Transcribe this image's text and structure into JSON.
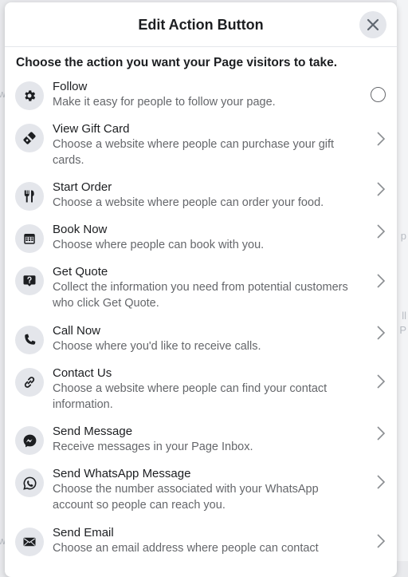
{
  "header": {
    "title": "Edit Action Button"
  },
  "subtitle": "Choose the action you want your Page visitors to take.",
  "items": [
    {
      "label": "Follow",
      "description": "Make it easy for people to follow your page.",
      "icon": "gear-icon",
      "control": "radio"
    },
    {
      "label": "View Gift Card",
      "description": "Choose a website where people can purchase your gift cards.",
      "icon": "gift-card-icon",
      "control": "chevron"
    },
    {
      "label": "Start Order",
      "description": "Choose a website where people can order your food.",
      "icon": "fork-knife-icon",
      "control": "chevron"
    },
    {
      "label": "Book Now",
      "description": "Choose where people can book with you.",
      "icon": "calendar-icon",
      "control": "chevron"
    },
    {
      "label": "Get Quote",
      "description": "Collect the information you need from potential customers who click Get Quote.",
      "icon": "question-bubble-icon",
      "control": "chevron"
    },
    {
      "label": "Call Now",
      "description": "Choose where you'd like to receive calls.",
      "icon": "phone-icon",
      "control": "chevron"
    },
    {
      "label": "Contact Us",
      "description": "Choose a website where people can find your contact information.",
      "icon": "link-icon",
      "control": "chevron"
    },
    {
      "label": "Send Message",
      "description": "Receive messages in your Page Inbox.",
      "icon": "messenger-icon",
      "control": "chevron"
    },
    {
      "label": "Send WhatsApp Message",
      "description": "Choose the number associated with your WhatsApp account so people can reach you.",
      "icon": "whatsapp-icon",
      "control": "chevron"
    },
    {
      "label": "Send Email",
      "description": "Choose an email address where people can contact",
      "icon": "envelope-icon",
      "control": "chevron"
    }
  ],
  "background": {
    "side_fragments": [
      "w",
      "w",
      "ll",
      "P",
      "p"
    ]
  }
}
